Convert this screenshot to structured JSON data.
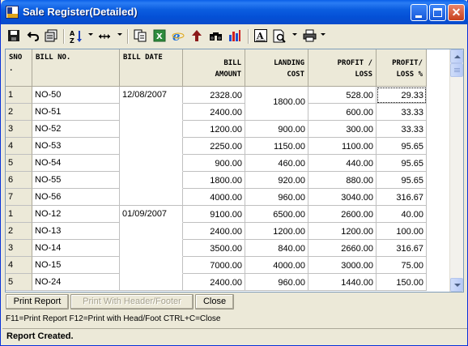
{
  "window": {
    "title": "Sale Register(Detailed)",
    "close_glyph": "✕"
  },
  "toolbar": {
    "icons": [
      "save-icon",
      "undo-icon",
      "print-preview-icon",
      "sort-icon",
      "column-width-icon",
      "copy-icon",
      "excel-icon",
      "ie-icon",
      "up-arrow-icon",
      "find-icon",
      "chart-icon",
      "font-icon",
      "preview-icon",
      "printer-icon"
    ]
  },
  "grid": {
    "headers": {
      "sno": [
        "SNO",
        "."
      ],
      "bill_no": [
        "BILL NO."
      ],
      "bill_date": [
        "BILL DATE"
      ],
      "bill_amount": [
        "BILL",
        "AMOUNT"
      ],
      "landing_cost": [
        "LANDING",
        "COST"
      ],
      "profit_loss": [
        "PROFIT /",
        "LOSS"
      ],
      "profit_loss_pct": [
        "PROFIT/",
        "LOSS %"
      ]
    },
    "rows": [
      {
        "sno": "1",
        "bill_no": "NO-50",
        "bill_date": "12/08/2007",
        "amount": "2328.00",
        "landing": "",
        "profit": "528.00",
        "pct": "29.33"
      },
      {
        "sno": "2",
        "bill_no": "NO-51",
        "bill_date": "",
        "amount": "2400.00",
        "landing": "",
        "profit": "600.00",
        "pct": "33.33"
      },
      {
        "sno": "3",
        "bill_no": "NO-52",
        "bill_date": "",
        "amount": "1200.00",
        "landing": "900.00",
        "profit": "300.00",
        "pct": "33.33"
      },
      {
        "sno": "4",
        "bill_no": "NO-53",
        "bill_date": "",
        "amount": "2250.00",
        "landing": "1150.00",
        "profit": "1100.00",
        "pct": "95.65"
      },
      {
        "sno": "5",
        "bill_no": "NO-54",
        "bill_date": "",
        "amount": "900.00",
        "landing": "460.00",
        "profit": "440.00",
        "pct": "95.65"
      },
      {
        "sno": "6",
        "bill_no": "NO-55",
        "bill_date": "",
        "amount": "1800.00",
        "landing": "920.00",
        "profit": "880.00",
        "pct": "95.65"
      },
      {
        "sno": "7",
        "bill_no": "NO-56",
        "bill_date": "",
        "amount": "4000.00",
        "landing": "960.00",
        "profit": "3040.00",
        "pct": "316.67"
      },
      {
        "sno": "1",
        "bill_no": "NO-12",
        "bill_date": "01/09/2007",
        "amount": "9100.00",
        "landing": "6500.00",
        "profit": "2600.00",
        "pct": "40.00"
      },
      {
        "sno": "2",
        "bill_no": "NO-13",
        "bill_date": "",
        "amount": "2400.00",
        "landing": "1200.00",
        "profit": "1200.00",
        "pct": "100.00"
      },
      {
        "sno": "3",
        "bill_no": "NO-14",
        "bill_date": "",
        "amount": "3500.00",
        "landing": "840.00",
        "profit": "2660.00",
        "pct": "316.67"
      },
      {
        "sno": "4",
        "bill_no": "NO-15",
        "bill_date": "",
        "amount": "7000.00",
        "landing": "4000.00",
        "profit": "3000.00",
        "pct": "75.00"
      },
      {
        "sno": "5",
        "bill_no": "NO-24",
        "bill_date": "",
        "amount": "2400.00",
        "landing": "960.00",
        "profit": "1440.00",
        "pct": "150.00"
      }
    ],
    "merged_landing": "1800.00"
  },
  "buttons": {
    "print_report": "Print Report",
    "print_header_footer": "Print With Header/Footer",
    "close": "Close"
  },
  "hint": "F11=Print Report  F12=Print with Head/Foot  CTRL+C=Close",
  "status": "Report Created."
}
